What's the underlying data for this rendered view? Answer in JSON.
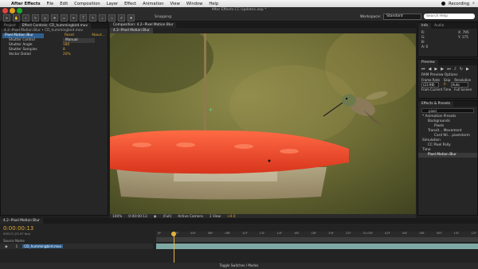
{
  "menubar": {
    "items": [
      "After Effects",
      "File",
      "Edit",
      "Composition",
      "Layer",
      "Effect",
      "Animation",
      "View",
      "Window",
      "Help"
    ],
    "recording": "Recording"
  },
  "toolbar": {
    "file_title": "After Effects CC Updates.aep *",
    "snapping": "Snapping",
    "workspace_label": "Workspace:",
    "workspace_value": "Standard",
    "search_placeholder": "Search Help"
  },
  "left_panel": {
    "tabs": [
      "Project",
      "Effect Controls: CD_hummingbird.mov"
    ],
    "breadcrumb": "4.2--Pixel Motion Blur • CD_hummingbird.mov",
    "effect_name": "Pixel Motion Blur",
    "reset": "Reset",
    "about": "About...",
    "props": [
      {
        "label": "Shutter Control",
        "value": "Manual"
      },
      {
        "label": "Shutter Angle",
        "value": "180"
      },
      {
        "label": "Shutter Samples",
        "value": "8"
      },
      {
        "label": "Vector Detail",
        "value": "20%"
      }
    ]
  },
  "viewer": {
    "tab": "Composition: 4.2--Pixel Motion Blur",
    "sub_tab": "4.2--Pixel Motion Blur",
    "zoom": "100%",
    "timecode": "0:00:00:13",
    "resolution": "(Full)",
    "camera": "Active Camera",
    "views": "1 View",
    "exposure": "+0.0"
  },
  "info_panel": {
    "tabs": [
      "Info",
      "Audio"
    ],
    "rgb": [
      "R:",
      "G:",
      "B:",
      "A: 0"
    ],
    "xy": [
      "X: 795",
      "Y: 175"
    ]
  },
  "preview_panel": {
    "title": "Preview",
    "ram_options": "RAM Preview Options",
    "labels": [
      "Frame Rate",
      "Skip",
      "Resolution"
    ],
    "values": [
      "(23.98)",
      "0",
      "Auto"
    ],
    "from_current": "From Current Time",
    "full_screen": "Full Screen"
  },
  "effects_panel": {
    "title": "Effects & Presets",
    "search_value": "pixel",
    "tree": [
      "* Animation Presets",
      "Backgrounds",
      "Pixels",
      "Transit... Movement",
      "Card Wi... pixelstorm",
      "Simulation",
      "CC Pixel Polly",
      "Time",
      "Pixel Motion Blur"
    ]
  },
  "timeline": {
    "tab": "4.2--Pixel Motion Blur",
    "timecode": "0:00:00:13",
    "fps_note": "00013 (23.97 fps)",
    "col_source": "Source Name",
    "layer_index": "1",
    "layer_name": "CD_hummingbird.mov",
    "ruler": [
      "0F",
      "02F",
      "04F",
      "06F",
      "08F",
      "10F",
      "12F",
      "14F",
      "16F",
      "18F",
      "20F",
      "22F",
      "01:00F",
      "02F",
      "04F",
      "06F",
      "08F",
      "10F",
      "12F"
    ],
    "toggle": "Toggle Switches / Modes"
  },
  "colors": {
    "accent": "#d9a73a",
    "feeder": "#e8452a",
    "selection": "#2f5f8f"
  }
}
